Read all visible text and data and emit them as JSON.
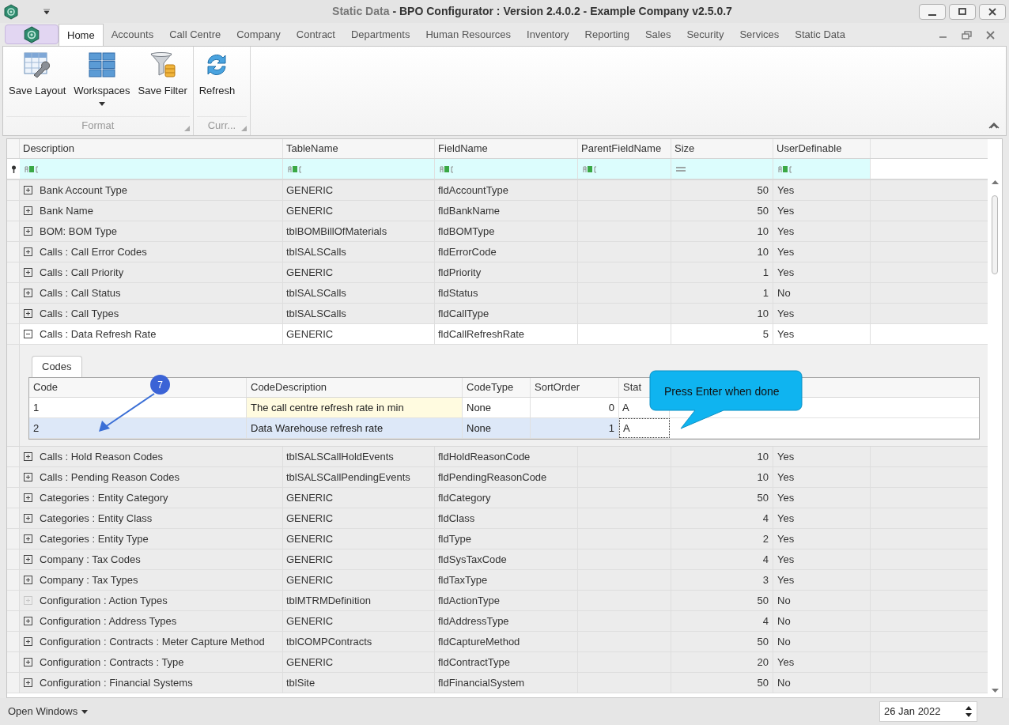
{
  "window": {
    "document": "Static Data",
    "title": "- BPO Configurator : Version 2.4.0.2 - Example Company v2.5.0.7"
  },
  "ribbon_tabs": [
    {
      "label": "Home",
      "selected": true
    },
    {
      "label": "Accounts",
      "selected": false
    },
    {
      "label": "Call Centre",
      "selected": false
    },
    {
      "label": "Company",
      "selected": false
    },
    {
      "label": "Contract",
      "selected": false
    },
    {
      "label": "Departments",
      "selected": false
    },
    {
      "label": "Human Resources",
      "selected": false
    },
    {
      "label": "Inventory",
      "selected": false
    },
    {
      "label": "Reporting",
      "selected": false
    },
    {
      "label": "Sales",
      "selected": false
    },
    {
      "label": "Security",
      "selected": false
    },
    {
      "label": "Services",
      "selected": false
    },
    {
      "label": "Static Data",
      "selected": false
    }
  ],
  "ribbon_groups": [
    {
      "label": "Format",
      "buttons": [
        {
          "label": "Save Layout",
          "dropdown": false
        },
        {
          "label": "Workspaces",
          "dropdown": true
        },
        {
          "label": "Save Filter",
          "dropdown": false
        }
      ]
    },
    {
      "label": "Curr...",
      "buttons": [
        {
          "label": "Refresh",
          "dropdown": false
        }
      ]
    }
  ],
  "grid": {
    "columns": [
      "Description",
      "TableName",
      "FieldName",
      "ParentFieldName",
      "Size",
      "UserDefinable"
    ],
    "filters": [
      {
        "kind": "text"
      },
      {
        "kind": "text"
      },
      {
        "kind": "text"
      },
      {
        "kind": "text"
      },
      {
        "kind": "number"
      },
      {
        "kind": "text"
      }
    ],
    "rows": [
      {
        "description": "Bank Account Type",
        "table": "GENERIC",
        "field": "fldAccountType",
        "size": "50",
        "user_definable": "Yes",
        "expandable": true,
        "expanded": false
      },
      {
        "description": "Bank Name",
        "table": "GENERIC",
        "field": "fldBankName",
        "size": "50",
        "user_definable": "Yes",
        "expandable": true,
        "expanded": false
      },
      {
        "description": "BOM: BOM Type",
        "table": "tblBOMBillOfMaterials",
        "field": "fldBOMType",
        "size": "10",
        "user_definable": "Yes",
        "expandable": true,
        "expanded": false
      },
      {
        "description": "Calls : Call Error Codes",
        "table": "tblSALSCalls",
        "field": "fldErrorCode",
        "size": "10",
        "user_definable": "Yes",
        "expandable": true,
        "expanded": false
      },
      {
        "description": "Calls : Call Priority",
        "table": "GENERIC",
        "field": "fldPriority",
        "size": "1",
        "user_definable": "Yes",
        "expandable": true,
        "expanded": false
      },
      {
        "description": "Calls : Call Status",
        "table": "tblSALSCalls",
        "field": "fldStatus",
        "size": "1",
        "user_definable": "No",
        "expandable": true,
        "expanded": false
      },
      {
        "description": "Calls : Call Types",
        "table": "tblSALSCalls",
        "field": "fldCallType",
        "size": "10",
        "user_definable": "Yes",
        "expandable": true,
        "expanded": false
      },
      {
        "description": "Calls : Data Refresh Rate",
        "table": "GENERIC",
        "field": "fldCallRefreshRate",
        "size": "5",
        "user_definable": "Yes",
        "expandable": true,
        "expanded": true,
        "detail": {
          "tab": "Codes",
          "columns": [
            "Code",
            "CodeDescription",
            "CodeType",
            "SortOrder",
            "Stat"
          ],
          "rows": [
            {
              "code": "1",
              "description": "The call centre refresh rate in min",
              "type": "None",
              "sort": "0",
              "status": "A",
              "selected": false
            },
            {
              "code": "2",
              "description": "Data Warehouse refresh rate",
              "type": "None",
              "sort": "1",
              "status": "A",
              "selected": true
            }
          ]
        }
      },
      {
        "description": "Calls : Hold Reason Codes",
        "table": "tblSALSCallHoldEvents",
        "field": "fldHoldReasonCode",
        "size": "10",
        "user_definable": "Yes",
        "expandable": true,
        "expanded": false
      },
      {
        "description": "Calls : Pending Reason Codes",
        "table": "tblSALSCallPendingEvents",
        "field": "fldPendingReasonCode",
        "size": "10",
        "user_definable": "Yes",
        "expandable": true,
        "expanded": false
      },
      {
        "description": "Categories : Entity Category",
        "table": "GENERIC",
        "field": "fldCategory",
        "size": "50",
        "user_definable": "Yes",
        "expandable": true,
        "expanded": false
      },
      {
        "description": "Categories : Entity Class",
        "table": "GENERIC",
        "field": "fldClass",
        "size": "4",
        "user_definable": "Yes",
        "expandable": true,
        "expanded": false
      },
      {
        "description": "Categories : Entity Type",
        "table": "GENERIC",
        "field": "fldType",
        "size": "2",
        "user_definable": "Yes",
        "expandable": true,
        "expanded": false
      },
      {
        "description": "Company : Tax Codes",
        "table": "GENERIC",
        "field": "fldSysTaxCode",
        "size": "4",
        "user_definable": "Yes",
        "expandable": true,
        "expanded": false
      },
      {
        "description": "Company : Tax Types",
        "table": "GENERIC",
        "field": "fldTaxType",
        "size": "3",
        "user_definable": "Yes",
        "expandable": true,
        "expanded": false
      },
      {
        "description": "Configuration : Action Types",
        "table": "tblMTRMDefinition",
        "field": "fldActionType",
        "size": "50",
        "user_definable": "No",
        "expandable": false,
        "expanded": false
      },
      {
        "description": "Configuration : Address Types",
        "table": "GENERIC",
        "field": "fldAddressType",
        "size": "4",
        "user_definable": "No",
        "expandable": true,
        "expanded": false
      },
      {
        "description": "Configuration : Contracts : Meter Capture Method",
        "table": "tblCOMPContracts",
        "field": "fldCaptureMethod",
        "size": "50",
        "user_definable": "No",
        "expandable": true,
        "expanded": false
      },
      {
        "description": "Configuration : Contracts : Type",
        "table": "GENERIC",
        "field": "fldContractType",
        "size": "20",
        "user_definable": "Yes",
        "expandable": true,
        "expanded": false
      },
      {
        "description": "Configuration : Financial Systems",
        "table": "tblSite",
        "field": "fldFinancialSystem",
        "size": "50",
        "user_definable": "No",
        "expandable": true,
        "expanded": false
      }
    ]
  },
  "annotation": {
    "marker": "7",
    "callout": "Press Enter when done"
  },
  "status_bar": {
    "open_windows": "Open Windows",
    "date": "26 Jan 2022"
  }
}
